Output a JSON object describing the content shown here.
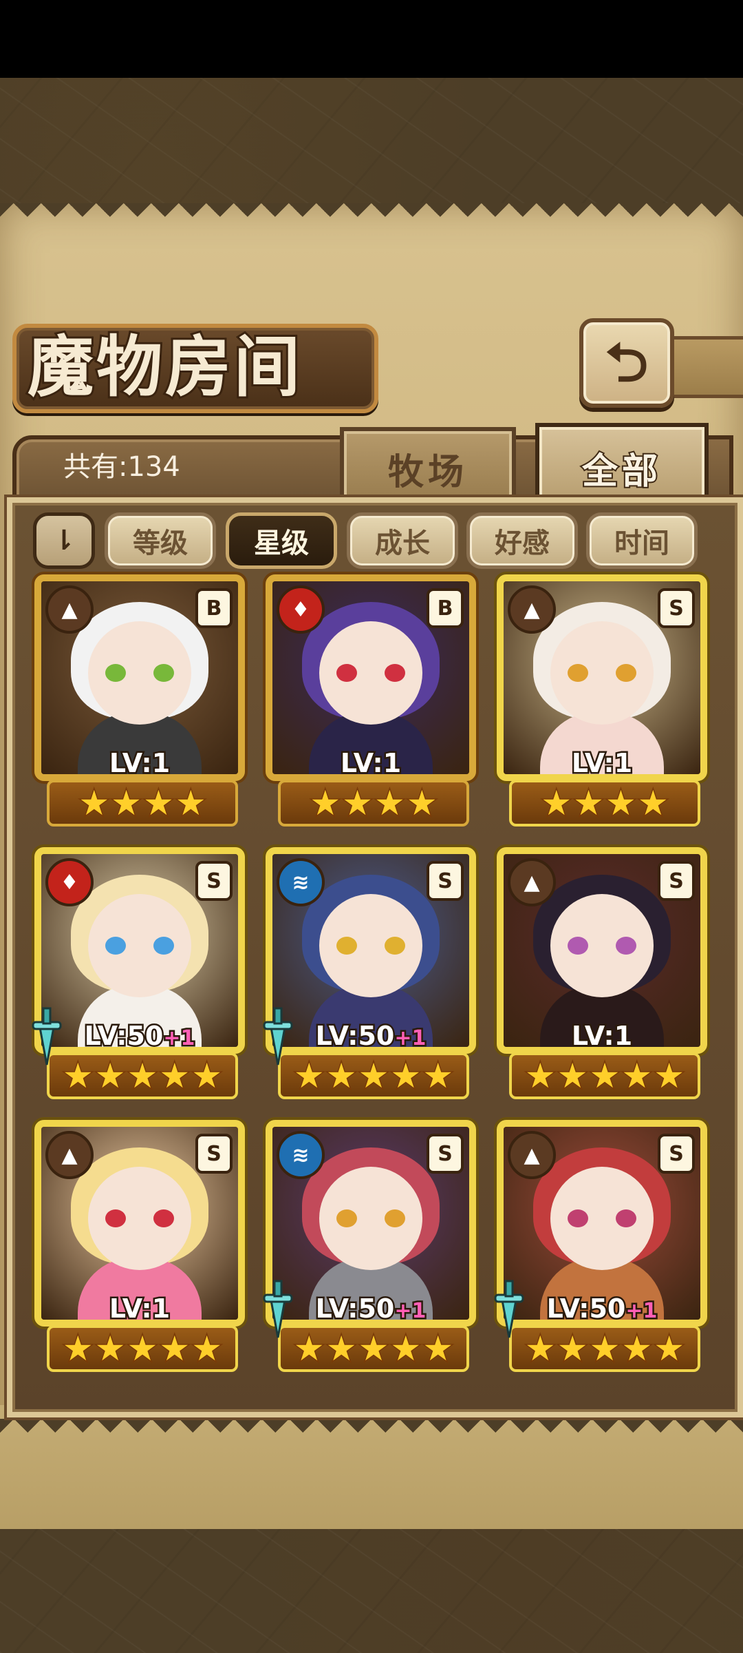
{
  "header": {
    "title": "魔物房间",
    "back_icon": "back-arrow-icon",
    "count_label": "共有:134"
  },
  "tabs": [
    {
      "label": "牧场",
      "active": false
    },
    {
      "label": "全部",
      "active": true
    }
  ],
  "sort": {
    "toggle_label": "⇂",
    "options": [
      {
        "label": "等级",
        "active": false
      },
      {
        "label": "星级",
        "active": true
      },
      {
        "label": "成长",
        "active": false
      },
      {
        "label": "好感",
        "active": false
      },
      {
        "label": "时间",
        "active": false
      }
    ]
  },
  "monsters": [
    {
      "element": "earth",
      "element_icon": "mountain-icon",
      "rank": "B",
      "level": "LV:1",
      "bonus": "",
      "stars": 4,
      "has_weapon": false,
      "frame": "bronze"
    },
    {
      "element": "fire",
      "element_icon": "flame-icon",
      "rank": "B",
      "level": "LV:1",
      "bonus": "",
      "stars": 4,
      "has_weapon": false,
      "frame": "bronze"
    },
    {
      "element": "earth",
      "element_icon": "mountain-icon",
      "rank": "S",
      "level": "LV:1",
      "bonus": "",
      "stars": 4,
      "has_weapon": false,
      "frame": "gold"
    },
    {
      "element": "fire",
      "element_icon": "flame-icon",
      "rank": "S",
      "level": "LV:50",
      "bonus": "+1",
      "stars": 5,
      "has_weapon": true,
      "frame": "gold"
    },
    {
      "element": "water",
      "element_icon": "waves-icon",
      "rank": "S",
      "level": "LV:50",
      "bonus": "+1",
      "stars": 5,
      "has_weapon": true,
      "frame": "gold"
    },
    {
      "element": "earth",
      "element_icon": "mountain-icon",
      "rank": "S",
      "level": "LV:1",
      "bonus": "",
      "stars": 5,
      "has_weapon": false,
      "frame": "gold"
    },
    {
      "element": "earth",
      "element_icon": "mountain-icon",
      "rank": "S",
      "level": "LV:1",
      "bonus": "",
      "stars": 5,
      "has_weapon": false,
      "frame": "gold"
    },
    {
      "element": "water",
      "element_icon": "waves-icon",
      "rank": "S",
      "level": "LV:50",
      "bonus": "+1",
      "stars": 5,
      "has_weapon": true,
      "frame": "gold"
    },
    {
      "element": "earth",
      "element_icon": "mountain-icon",
      "rank": "S",
      "level": "LV:50",
      "bonus": "+1",
      "stars": 5,
      "has_weapon": true,
      "frame": "gold"
    }
  ]
}
